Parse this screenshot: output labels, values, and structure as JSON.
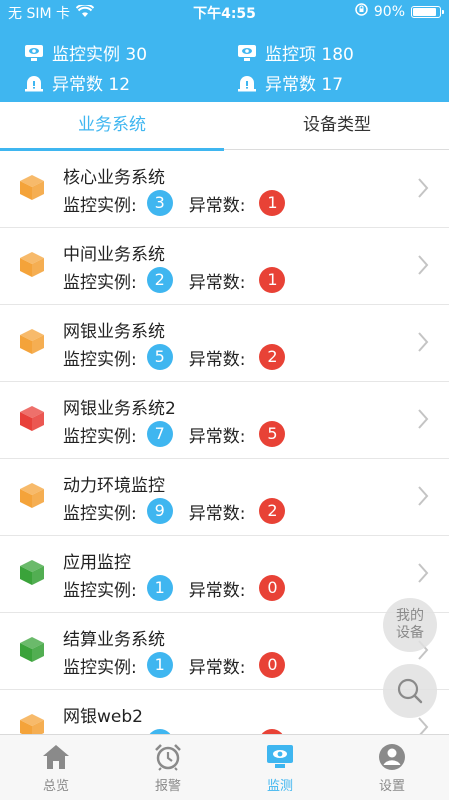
{
  "status_bar": {
    "carrier": "无 SIM 卡",
    "time": "下午4:55",
    "battery_text": "90%",
    "battery_level": 0.9
  },
  "summary": {
    "monitored_instances": "监控实例 30",
    "monitored_items": "监控项 180",
    "abnormal_count": "异常数 12",
    "abnormal_count_2": "异常数 17"
  },
  "tabs": [
    {
      "label": "业务系统",
      "active": true
    },
    {
      "label": "设备类型",
      "active": false
    }
  ],
  "labels": {
    "instances": "监控实例:",
    "abnormal": "异常数:"
  },
  "systems": [
    {
      "name": "核心业务系统",
      "instances": "3",
      "abnormal": "1",
      "cube_color": "#f4a33a"
    },
    {
      "name": "中间业务系统",
      "instances": "2",
      "abnormal": "1",
      "cube_color": "#f4a33a"
    },
    {
      "name": "网银业务系统",
      "instances": "5",
      "abnormal": "2",
      "cube_color": "#f4a33a"
    },
    {
      "name": "网银业务系统2",
      "instances": "7",
      "abnormal": "5",
      "cube_color": "#e8403a"
    },
    {
      "name": "动力环境监控",
      "instances": "9",
      "abnormal": "2",
      "cube_color": "#f4a33a"
    },
    {
      "name": "应用监控",
      "instances": "1",
      "abnormal": "0",
      "cube_color": "#3aa33a"
    },
    {
      "name": "结算业务系统",
      "instances": "1",
      "abnormal": "0",
      "cube_color": "#3aa33a"
    },
    {
      "name": "网银web2",
      "instances": "",
      "abnormal": "",
      "cube_color": "#f4a33a"
    }
  ],
  "fab": {
    "my_device_line1": "我的",
    "my_device_line2": "设备"
  },
  "tabbar": [
    {
      "label": "总览",
      "icon": "home-icon",
      "active": false
    },
    {
      "label": "报警",
      "icon": "alarm-clock-icon",
      "active": false
    },
    {
      "label": "监测",
      "icon": "monitor-icon",
      "active": true
    },
    {
      "label": "设置",
      "icon": "user-icon",
      "active": false
    }
  ],
  "colors": {
    "accent": "#3fb6f0",
    "badge_blue": "#3fb6f0",
    "badge_red": "#e84236",
    "cube_orange": "#f4a33a",
    "cube_red": "#e8403a",
    "cube_green": "#3aa33a"
  }
}
